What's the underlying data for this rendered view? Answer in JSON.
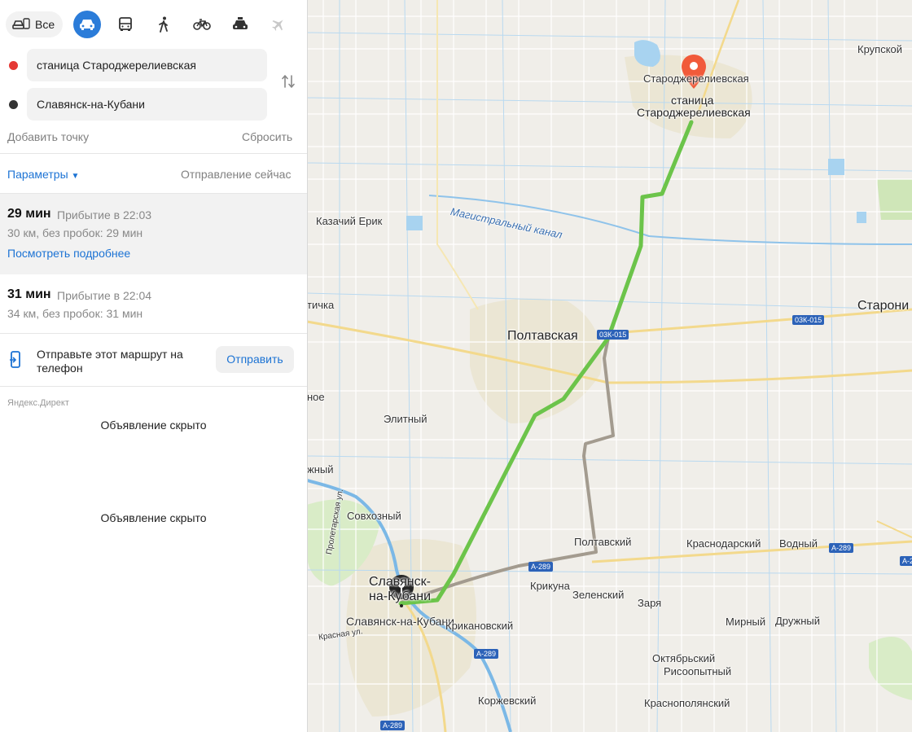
{
  "modes": {
    "all_label": "Все",
    "items": [
      {
        "name": "car-mode",
        "icon": "car-icon",
        "active": true
      },
      {
        "name": "transit-mode",
        "icon": "bus-icon",
        "active": false
      },
      {
        "name": "walk-mode",
        "icon": "walker-icon",
        "active": false
      },
      {
        "name": "bike-mode",
        "icon": "bicycle-icon",
        "active": false
      },
      {
        "name": "taxi-mode",
        "icon": "taxi-icon",
        "active": false
      },
      {
        "name": "plane-mode",
        "icon": "plane-icon",
        "active": false
      }
    ]
  },
  "route": {
    "from": "станица Староджерелиевская",
    "to": "Славянск-на-Кубани",
    "add_point": "Добавить точку",
    "reset": "Сбросить",
    "from_color": "#e53935",
    "to_color": "#333333"
  },
  "params": {
    "label": "Параметры",
    "departure": "Отправление сейчас"
  },
  "variants": [
    {
      "time": "29 мин",
      "arrival": "Прибытие в 22:03",
      "details": "30 км, без пробок: 29 мин",
      "link": "Посмотреть подробнее",
      "selected": true
    },
    {
      "time": "31 мин",
      "arrival": "Прибытие в 22:04",
      "details": "34 км, без пробок: 31 мин",
      "selected": false
    }
  ],
  "send": {
    "text": "Отправьте этот маршрут на телефон",
    "button": "Отправить"
  },
  "direct": {
    "label": "Яндекс.Директ",
    "ad1": "Объявление скрыто",
    "ad2": "Объявление скрыто"
  },
  "map": {
    "route_color": "#6cc44a",
    "alt_route_color": "#a39b8f",
    "water_color": "#a8d3f0",
    "labels": {
      "krupskoy": "Крупской",
      "starodzh_small": "Староджерелиевская",
      "starodzh_1": "станица",
      "starodzh_2": "Староджерелиевская",
      "kazachiy": "Казачий Ерик",
      "kanal": "Магистральный канал",
      "poltavskaya": "Полтавская",
      "staroni": "Старони",
      "tichka": "тичка",
      "noe": "ное",
      "elitny": "Элитный",
      "zhny": "жный",
      "sovkhozny": "Совхозный",
      "poltavskiy": "Полтавский",
      "krasnodarskiy": "Краснодарский",
      "vodny": "Водный",
      "krikuna": "Крикуна",
      "zelenskiy": "Зеленский",
      "zarya": "Заря",
      "mirny": "Мирный",
      "druzhny": "Дружный",
      "slav_1": "Славянск-",
      "slav_2": "на-Кубани",
      "slav_small": "Славянск-на-Кубани",
      "krikanovskiy": "Крикановский",
      "oktyabrskiy": "Октябрьский",
      "risoopytny": "Рисоопытный",
      "korzhevskiy": "Коржевский",
      "krasnopolyanskiy": "Краснополянский",
      "proletarskaya": "Пролетарская ул.",
      "krasnaya": "Красная ул.",
      "shield_03k_a": "03К-015",
      "shield_03k_b": "03К-015",
      "shield_a289_a": "А-289",
      "shield_a289_b": "А-289",
      "shield_a289_c": "А-289",
      "shield_a289_d": "А-289",
      "shield_a289_e": "А-289"
    }
  }
}
